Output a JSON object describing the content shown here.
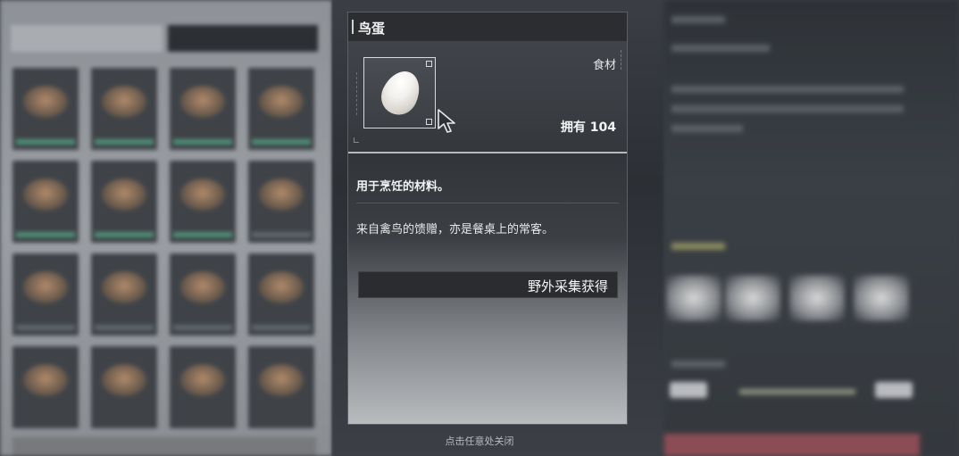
{
  "item": {
    "name": "鸟蛋",
    "category": "食材",
    "owned_label": "拥有 104",
    "description_short": "用于烹饪的材料。",
    "description_flavor": "来自禽鸟的馈赠，亦是餐桌上的常客。",
    "source": "野外采集获得",
    "icon": "egg-icon"
  },
  "footer": {
    "close_hint": "点击任意处关闭"
  },
  "colors": {
    "card_header": "#2b2d30",
    "source_button": "#2a2c2f",
    "accent_rule": "#b6babe",
    "bg_cta": "#8c4c55"
  }
}
